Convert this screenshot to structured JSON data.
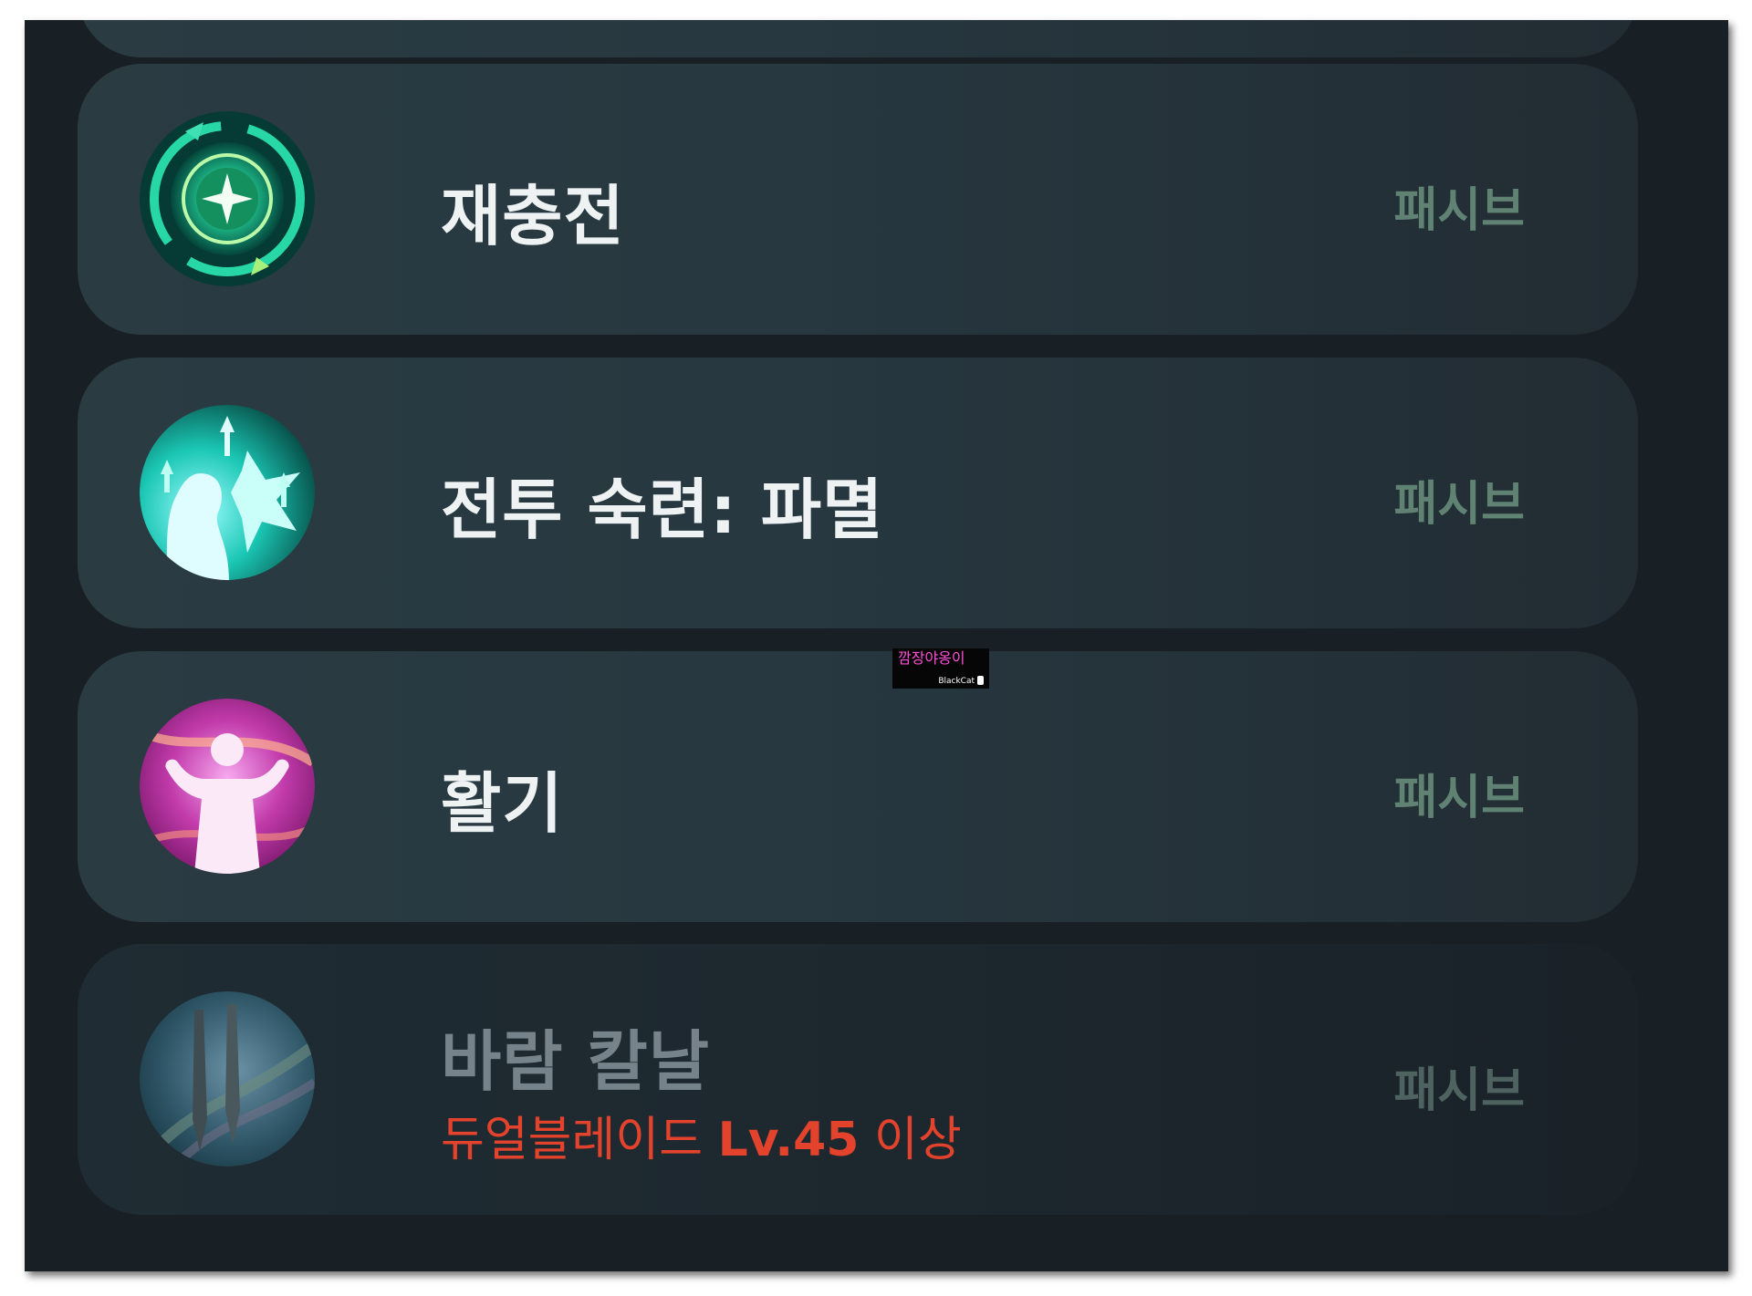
{
  "skills": [
    {
      "name": "재충전",
      "type": "패시브",
      "icon": "recharge-compass-icon"
    },
    {
      "name": "전투 숙련: 파멸",
      "type": "패시브",
      "icon": "battle-mastery-icon"
    },
    {
      "name": "활기",
      "type": "패시브",
      "icon": "vigor-flex-icon"
    },
    {
      "name": "바람 칼날",
      "type": "패시브",
      "icon": "wind-blade-icon",
      "locked": true,
      "requirement": {
        "class": "듀얼블레이드",
        "level": "Lv.45",
        "suffix": "이상"
      }
    }
  ],
  "watermark": {
    "text": "깜장야옹이",
    "sub": "BlackCat"
  },
  "colors": {
    "card": "#2a3b42",
    "background": "#182025",
    "requirement": "#e3432c",
    "type_label": "#5f8272"
  }
}
